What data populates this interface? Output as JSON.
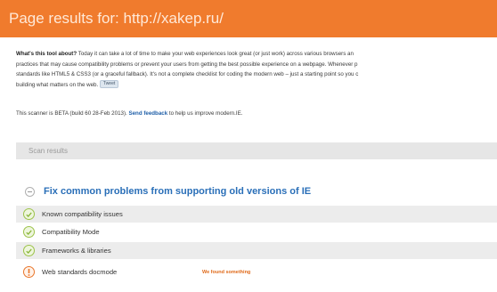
{
  "header": {
    "title": "Page results for: http://xakep.ru/"
  },
  "intro": {
    "question": "What's this tool about?",
    "line1": "Today it can take a lot of time to make your web experiences look great (or just work) across various browsers an",
    "line2": "practices that may cause compatibility problems or prevent your users from getting the best possible experience on a webpage. Whenever p",
    "line3": "standards like HTML5 & CSS3 (or a graceful fallback). It's not a complete checklist for coding the modern web – just a starting point so you c",
    "line4": "building what matters on the web.",
    "tweet_label": "Tweet"
  },
  "beta": {
    "prefix": "This scanner is BETA (build 60 28-Feb 2013).",
    "link": "Send feedback",
    "suffix": "to help us improve modern.IE."
  },
  "scan": {
    "label": "Scan results"
  },
  "section": {
    "title": "Fix common problems from supporting old versions of IE"
  },
  "rows": [
    {
      "label": "Known compatibility issues",
      "status": "",
      "state": "ok"
    },
    {
      "label": "Compatibility Mode",
      "status": "",
      "state": "ok"
    },
    {
      "label": "Frameworks & libraries",
      "status": "",
      "state": "ok"
    },
    {
      "label": "Web standards docmode",
      "status": "We found something",
      "state": "warn"
    }
  ],
  "colors": {
    "header": "#f07b2d",
    "ok": "#9cc24a",
    "warn": "#e9762b",
    "link": "#2a6fb8"
  }
}
